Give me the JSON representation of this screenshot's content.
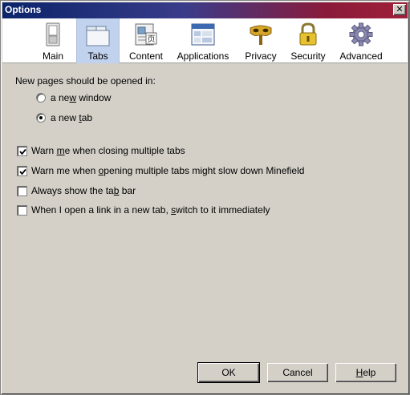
{
  "window": {
    "title": "Options",
    "close_label": "✕"
  },
  "panes": [
    {
      "label": "Main",
      "icon": "switch-icon"
    },
    {
      "label": "Tabs",
      "icon": "tabs-window-icon",
      "selected": true
    },
    {
      "label": "Content",
      "icon": "content-document-icon"
    },
    {
      "label": "Applications",
      "icon": "applications-window-icon"
    },
    {
      "label": "Privacy",
      "icon": "privacy-mask-icon"
    },
    {
      "label": "Security",
      "icon": "security-lock-icon"
    },
    {
      "label": "Advanced",
      "icon": "advanced-gear-icon"
    }
  ],
  "tabs_pane": {
    "heading": "New pages should be opened in:",
    "radios": [
      {
        "pre": "a ne",
        "key": "w",
        "post": " window",
        "checked": false
      },
      {
        "pre": "a new ",
        "key": "t",
        "post": "ab",
        "checked": true
      }
    ],
    "checkboxes": [
      {
        "pre": "Warn ",
        "key": "m",
        "post": "e when closing multiple tabs",
        "checked": true
      },
      {
        "pre": "Warn me when ",
        "key": "o",
        "post": "pening multiple tabs might slow down Minefield",
        "checked": true
      },
      {
        "pre": "Always show the ta",
        "key": "b",
        "post": " bar",
        "checked": false
      },
      {
        "pre": "When I open a link in a new tab, ",
        "key": "s",
        "post": "witch to it immediately",
        "checked": false
      }
    ]
  },
  "buttons": {
    "ok": "OK",
    "cancel": "Cancel",
    "help": {
      "pre": "",
      "key": "H",
      "post": "elp"
    }
  },
  "colors": {
    "dialog_bg": "#d4d0c8",
    "toolbar_bg": "#ffffff",
    "selected_pane_bg": "#c1d2ee",
    "title_gradient_start": "#0a246a",
    "title_gradient_end": "#a0203a"
  }
}
